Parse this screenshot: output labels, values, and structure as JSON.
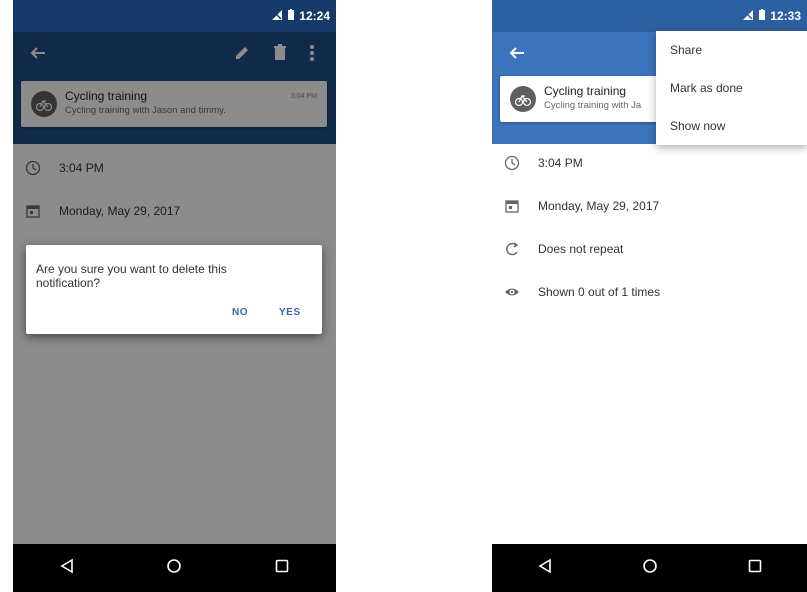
{
  "left": {
    "status_time": "12:24",
    "card": {
      "title": "Cycling training",
      "subtitle": "Cycling training with Jason and timmy.",
      "time": "3:04 PM"
    },
    "details": {
      "time": "3:04 PM",
      "date": "Monday, May 29, 2017"
    },
    "dialog": {
      "message": "Are you sure you want to delete this notification?",
      "no_label": "NO",
      "yes_label": "YES"
    }
  },
  "right": {
    "status_time": "12:33",
    "card": {
      "title": "Cycling training",
      "subtitle": "Cycling training with Ja"
    },
    "menu": {
      "items": [
        "Share",
        "Mark as done",
        "Show now"
      ]
    },
    "details": {
      "time": "3:04 PM",
      "date": "Monday, May 29, 2017",
      "repeat": "Does not repeat",
      "shown": "Shown 0 out of 1 times"
    }
  },
  "colors": {
    "primary_dark": "#163a68",
    "primary": "#1f4e86",
    "dialog_button": "#3a64b4",
    "nav_bar": "#000000"
  },
  "icons": [
    "back-arrow-icon",
    "edit-icon",
    "delete-icon",
    "overflow-menu-icon",
    "bicycle-icon",
    "clock-icon",
    "calendar-icon",
    "repeat-icon",
    "eye-icon",
    "nav-back-icon",
    "nav-home-icon",
    "nav-recents-icon",
    "signal-icon",
    "battery-icon"
  ]
}
